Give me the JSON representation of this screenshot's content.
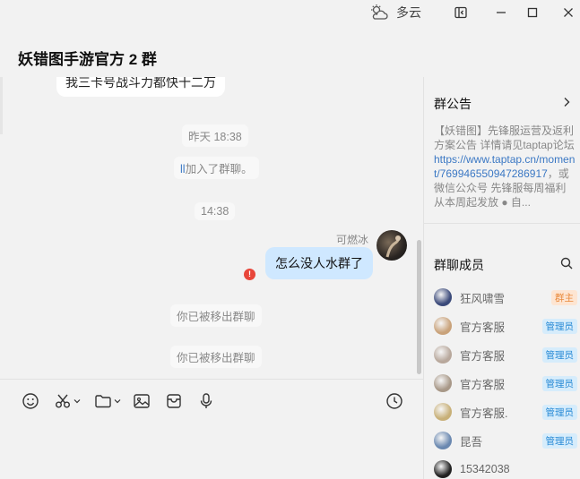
{
  "window": {
    "weather_text": "多云",
    "chat_title": "妖错图手游官方 2 群"
  },
  "chat": {
    "partial_message": "我三卡号战斗力都快十二万",
    "time_yesterday": "昨天 18:38",
    "join_user": "ll",
    "join_text": "加入了群聊。",
    "time_today": "14:38",
    "sender_name": "可燃冰",
    "my_message": "怎么没人水群了",
    "error_mark": "!",
    "removed_notice_1": "你已被移出群聊",
    "removed_notice_2": "你已被移出群聊"
  },
  "toolbar": {
    "icons": [
      "emoji-icon",
      "scissors-icon",
      "folder-icon",
      "image-icon",
      "box-icon",
      "microphone-icon",
      "clock-icon"
    ]
  },
  "panel": {
    "announcement_title": "群公告",
    "announcement_prefix": "【妖错图】先锋服运营及返利方案公告 详情请见taptap论坛",
    "announcement_link": "https://www.taptap.cn/moment/769946550947286917",
    "announcement_suffix": "，或微信公众号 先锋服每周福利从本周起发放 ● 自...",
    "members_title": "群聊成员",
    "members": [
      {
        "name": "狂风啸雪",
        "badge": "群主",
        "role": "owner",
        "avatar_color": "#3b4a7a"
      },
      {
        "name": "官方客服",
        "badge": "管理员",
        "role": "admin",
        "avatar_color": "#c9a27a"
      },
      {
        "name": "官方客服",
        "badge": "管理员",
        "role": "admin",
        "avatar_color": "#b8a89c"
      },
      {
        "name": "官方客服",
        "badge": "管理员",
        "role": "admin",
        "avatar_color": "#a89888"
      },
      {
        "name": "官方客服.",
        "badge": "管理员",
        "role": "admin",
        "avatar_color": "#c8b078"
      },
      {
        "name": "昆吾",
        "badge": "管理员",
        "role": "admin",
        "avatar_color": "#6a88b0"
      },
      {
        "name": "15342038",
        "badge": "",
        "role": "member",
        "avatar_color": "#222222"
      }
    ]
  },
  "colors": {
    "my_bubble": "#cfe8ff",
    "link": "#3b78c4",
    "owner_badge": "#e98a3c",
    "admin_badge": "#2a8bd6",
    "error": "#e8463a"
  }
}
